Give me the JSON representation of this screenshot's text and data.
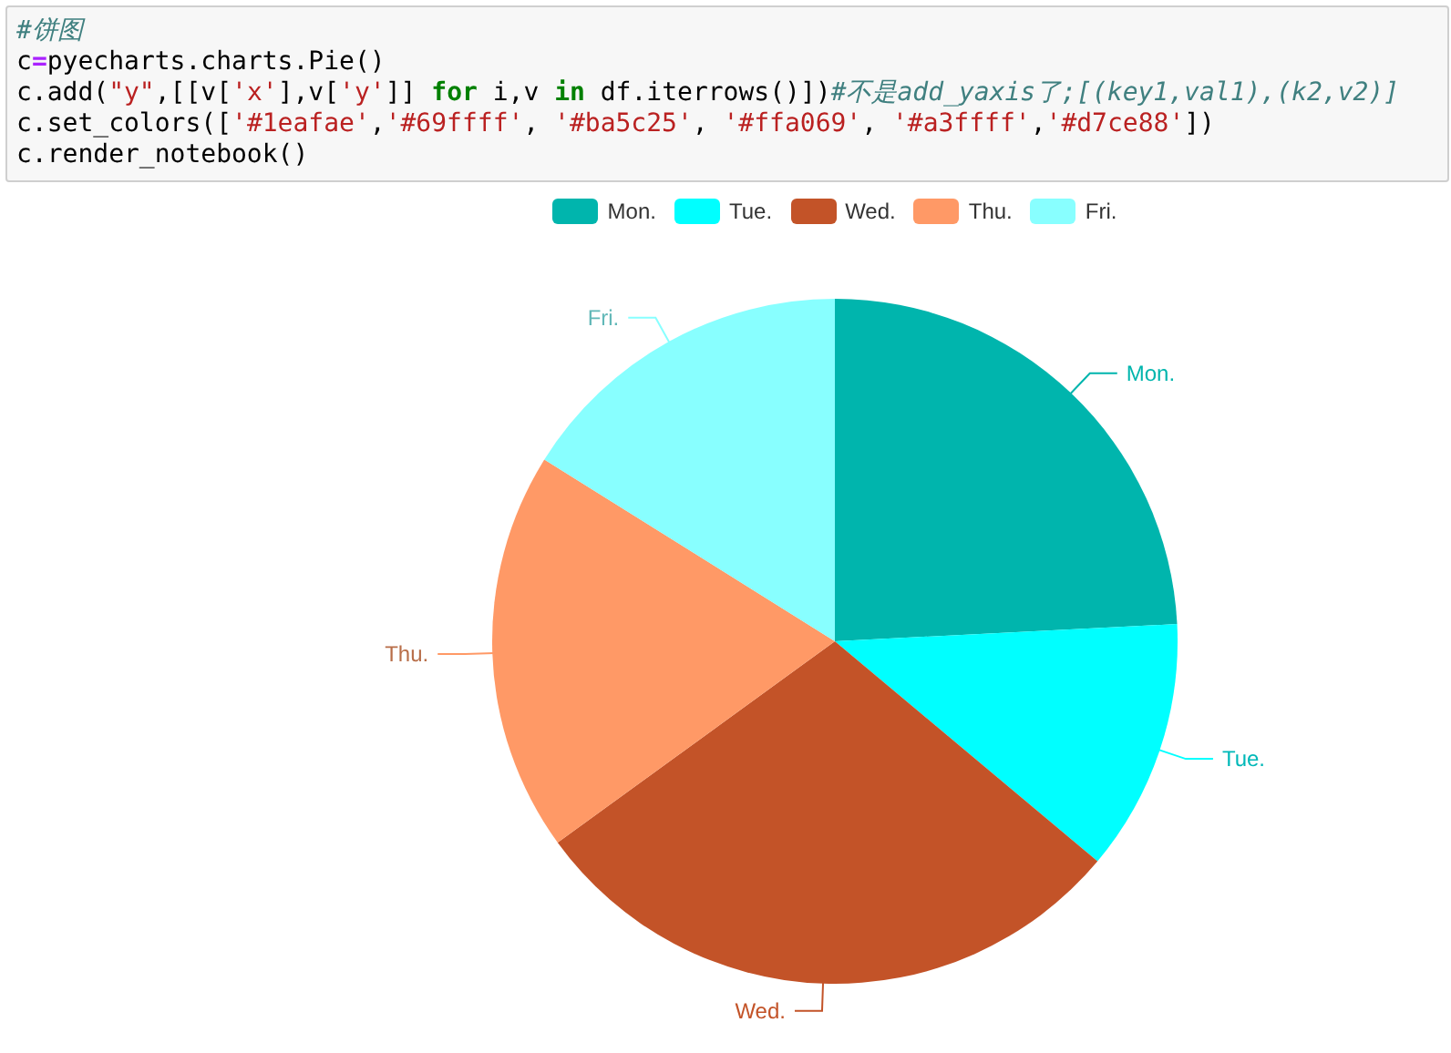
{
  "code_cell": {
    "lines": [
      [
        {
          "kind": "comment",
          "text": "#饼图"
        }
      ],
      [
        {
          "kind": "plain",
          "text": "c"
        },
        {
          "kind": "op",
          "text": "="
        },
        {
          "kind": "plain",
          "text": "pyecharts.charts.Pie()"
        }
      ],
      [
        {
          "kind": "plain",
          "text": "c.add("
        },
        {
          "kind": "string",
          "text": "\"y\""
        },
        {
          "kind": "plain",
          "text": ",[[v["
        },
        {
          "kind": "string",
          "text": "'x'"
        },
        {
          "kind": "plain",
          "text": "],v["
        },
        {
          "kind": "string",
          "text": "'y'"
        },
        {
          "kind": "plain",
          "text": "]] "
        },
        {
          "kind": "keyword",
          "text": "for"
        },
        {
          "kind": "plain",
          "text": " i,v "
        },
        {
          "kind": "keyword",
          "text": "in"
        },
        {
          "kind": "plain",
          "text": " df.iterrows()])"
        },
        {
          "kind": "comment",
          "text": "#不是add_yaxis了;[(key1,val1),(k2,v2)]"
        }
      ],
      [
        {
          "kind": "plain",
          "text": "c.set_colors(["
        },
        {
          "kind": "string",
          "text": "'#1eafae'"
        },
        {
          "kind": "plain",
          "text": ","
        },
        {
          "kind": "string",
          "text": "'#69ffff'"
        },
        {
          "kind": "plain",
          "text": ", "
        },
        {
          "kind": "string",
          "text": "'#ba5c25'"
        },
        {
          "kind": "plain",
          "text": ", "
        },
        {
          "kind": "string",
          "text": "'#ffa069'"
        },
        {
          "kind": "plain",
          "text": ", "
        },
        {
          "kind": "string",
          "text": "'#a3ffff'"
        },
        {
          "kind": "plain",
          "text": ","
        },
        {
          "kind": "string",
          "text": "'#d7ce88'"
        },
        {
          "kind": "plain",
          "text": "])"
        }
      ],
      [
        {
          "kind": "plain",
          "text": "c.render_notebook()"
        }
      ]
    ]
  },
  "legend": [
    {
      "label": "Mon.",
      "color": "#00b5ad"
    },
    {
      "label": "Tue.",
      "color": "#00ffff"
    },
    {
      "label": "Wed.",
      "color": "#c35328"
    },
    {
      "label": "Thu.",
      "color": "#ff9966"
    },
    {
      "label": "Fri.",
      "color": "#88ffff"
    }
  ],
  "chart_data": {
    "type": "pie",
    "categories": [
      "Mon.",
      "Tue.",
      "Wed.",
      "Thu.",
      "Fri."
    ],
    "series": [
      {
        "values": [
          24.2,
          11.9,
          28.9,
          18.9,
          16.1
        ]
      }
    ]
  }
}
